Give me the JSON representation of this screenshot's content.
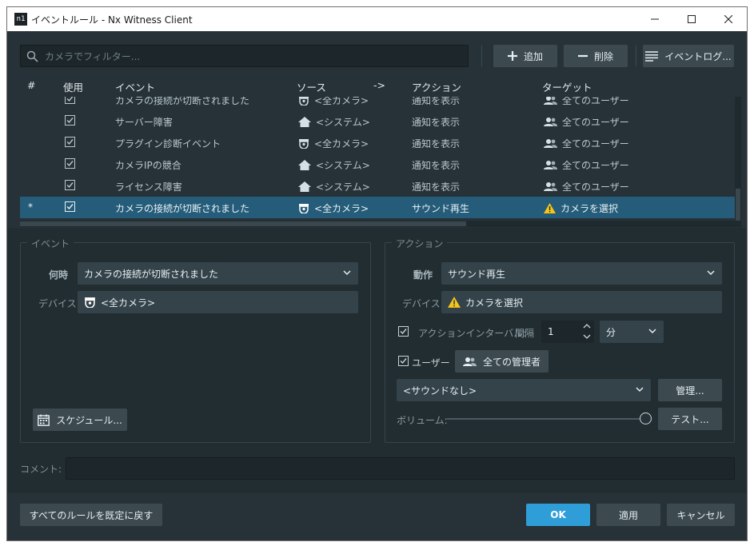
{
  "window": {
    "title": "イベントルール - Nx Witness Client",
    "app_icon_text": "n1"
  },
  "toolbar": {
    "filter_placeholder": "カメラでフィルター...",
    "add_label": "追加",
    "delete_label": "削除",
    "event_log_label": "イベントログ..."
  },
  "table": {
    "columns": {
      "num": "#",
      "enabled": "使用",
      "event": "イベント",
      "source": "ソース",
      "arrow": "->",
      "action": "アクション",
      "target": "ターゲット"
    },
    "rows": [
      {
        "num": "",
        "event": "カメラの接続が切断されました",
        "source_icon": "camera-icon",
        "source": "<全カメラ>",
        "action": "通知を表示",
        "target_icon": "users-icon",
        "target": "全てのユーザー"
      },
      {
        "num": "",
        "event": "サーバー障害",
        "source_icon": "home-icon",
        "source": "<システム>",
        "action": "通知を表示",
        "target_icon": "users-icon",
        "target": "全てのユーザー"
      },
      {
        "num": "",
        "event": "プラグイン診断イベント",
        "source_icon": "camera-icon",
        "source": "<全カメラ>",
        "action": "通知を表示",
        "target_icon": "users-icon",
        "target": "全てのユーザー"
      },
      {
        "num": "",
        "event": "カメラIPの競合",
        "source_icon": "home-icon",
        "source": "<システム>",
        "action": "通知を表示",
        "target_icon": "users-icon",
        "target": "全てのユーザー"
      },
      {
        "num": "",
        "event": "ライセンス障害",
        "source_icon": "home-icon",
        "source": "<システム>",
        "action": "通知を表示",
        "target_icon": "users-icon",
        "target": "全てのユーザー"
      },
      {
        "num": "*",
        "event": "カメラの接続が切断されました",
        "source_icon": "camera-icon",
        "source": "<全カメラ>",
        "action": "サウンド再生",
        "target_icon": "warning-icon",
        "target": "カメラを選択"
      }
    ]
  },
  "event_panel": {
    "group_label": "イベント",
    "when_label": "何時",
    "when_value": "カメラの接続が切断されました",
    "device_label": "デバイス",
    "device_value": "<全カメラ>",
    "schedule_label": "スケジュール..."
  },
  "action_panel": {
    "group_label": "アクション",
    "action_label": "動作",
    "action_value": "サウンド再生",
    "device_label": "デバイス",
    "device_value": "カメラを選択",
    "interval_label": "アクションインターバル:",
    "interval_sub_label": "間隔",
    "interval_value": "1",
    "interval_unit": "分",
    "users_label": "ユーザー",
    "users_value": "全ての管理者",
    "sound_value": "<サウンドなし>",
    "manage_label": "管理...",
    "volume_label": "ボリューム:",
    "volume_level": 1.0,
    "test_label": "テスト..."
  },
  "comment": {
    "label": "コメント:",
    "value": ""
  },
  "footer": {
    "reset_label": "すべてのルールを既定に戻す",
    "ok_label": "OK",
    "apply_label": "適用",
    "cancel_label": "キャンセル"
  },
  "colors": {
    "background": "#263237",
    "selected_row": "#255c79",
    "primary_button": "#2f9ed8",
    "warning": "#f5c518"
  }
}
